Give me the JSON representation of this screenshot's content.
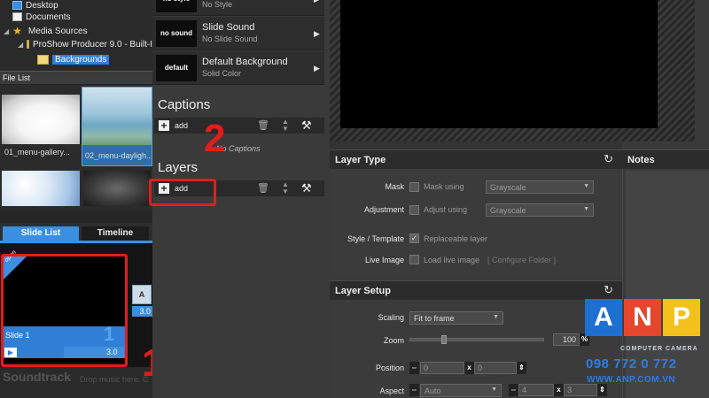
{
  "tree": {
    "items": [
      {
        "label": "Desktop",
        "icon": "desktop-icon"
      },
      {
        "label": "Documents",
        "icon": "documents-icon"
      },
      {
        "label": "Media Sources",
        "icon": "star-icon"
      },
      {
        "label": "ProShow Producer 9.0 - Built-I",
        "icon": "folder-icon"
      },
      {
        "label": "Backgrounds",
        "icon": "folder-icon"
      }
    ]
  },
  "file_list": {
    "header": "File List",
    "files": [
      {
        "name": "01_menu-gallery..."
      },
      {
        "name": "02_menu-dayligh..."
      },
      {
        "name": ""
      },
      {
        "name": ""
      }
    ]
  },
  "slide_tabs": {
    "active": "Slide List",
    "inactive": "Timeline"
  },
  "slide": {
    "name": "Slide 1",
    "number": "1",
    "duration": "3.0",
    "badge": "open",
    "transition_duration": "3.0",
    "transition_icon": "A"
  },
  "soundtrack": {
    "title": "Soundtrack",
    "hint": "Drop music here. C"
  },
  "style_list": [
    {
      "thumb": "no style",
      "name": "",
      "sub": "No Style"
    },
    {
      "thumb": "no sound",
      "name": "Slide Sound",
      "sub": "No Slide Sound"
    },
    {
      "thumb": "default",
      "name": "Default Background",
      "sub": "Solid Color"
    }
  ],
  "captions": {
    "title": "Captions",
    "add_label": "add",
    "empty_text": "No Captions"
  },
  "layers": {
    "title": "Layers",
    "add_label": "add"
  },
  "annotations": {
    "one": "1",
    "two": "2"
  },
  "layer_type": {
    "title": "Layer Type",
    "mask_label": "Mask",
    "mask_check": "Mask using",
    "mask_dropdown": "Grayscale",
    "adjust_label": "Adjustment",
    "adjust_check": "Adjust using",
    "adjust_dropdown": "Grayscale",
    "style_label": "Style / Template",
    "style_check": "Replaceable layer",
    "live_label": "Live Image",
    "live_check": "Load live image",
    "configure": "[ Configure Folder ]"
  },
  "layer_setup": {
    "title": "Layer Setup",
    "scaling_label": "Scaling",
    "scaling_value": "Fit to frame",
    "zoom_label": "Zoom",
    "zoom_value": "100",
    "zoom_unit": "%",
    "position_label": "Position",
    "pos_x": "0",
    "pos_sep": "x",
    "pos_y": "0",
    "aspect_label": "Aspect",
    "aspect_value": "Auto",
    "aspect_w": "4",
    "aspect_sep": "x",
    "aspect_h": "3"
  },
  "notes": {
    "title": "Notes"
  },
  "watermark": {
    "letters": [
      "A",
      "N",
      "P"
    ],
    "tagline": "COMPUTER  CAMERA",
    "phone": "098 772 0 772",
    "url": "WWW.ANP.COM.VN",
    "colors": {
      "a": "#1f6fd0",
      "n": "#e5462d",
      "p": "#f2c11b"
    }
  }
}
